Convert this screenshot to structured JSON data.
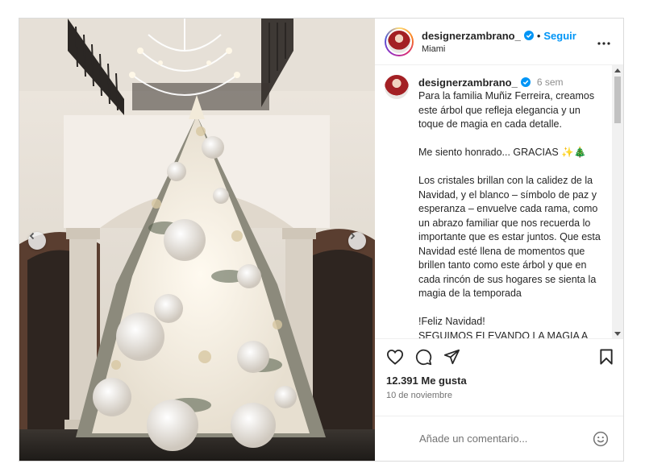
{
  "post": {
    "username": "designerzambrano_",
    "follow_label": "Seguir",
    "location": "Miami",
    "caption_time": "6 sem",
    "caption": "Para la familia Muñiz Ferreira, creamos este árbol que refleja elegancia y un toque de magia en cada detalle.\n\nMe siento honrado... GRACIAS ✨🎄\n\nLos cristales brillan con la calidez de la Navidad, y el blanco – símbolo de paz y esperanza – envuelve cada rama, como un abrazo familiar que nos recuerda lo importante que es estar juntos. Que esta Navidad esté llena de momentos que brillen tanto como este árbol y que en cada rincón de sus hogares se sienta la magia de la temporada\n\n!Feliz Navidad!\nSEGUIMOS ELEVANDO LA MAGIA A UN NIVEL REAL ✨👑🎄",
    "likes": "12.391 Me gusta",
    "date": "10 de noviembre",
    "comment_placeholder": "Añade un comentario..."
  },
  "colors": {
    "accent": "#0095f6",
    "verified": "#0095f6",
    "text": "#262626",
    "muted": "#737373"
  },
  "icons": {
    "prev": "chevron-left-icon",
    "next": "chevron-right-icon",
    "more": "more-horizontal-icon",
    "like": "heart-icon",
    "comment": "comment-icon",
    "share": "share-icon",
    "save": "bookmark-icon",
    "emoji": "emoji-icon",
    "verified": "verified-badge-icon"
  }
}
